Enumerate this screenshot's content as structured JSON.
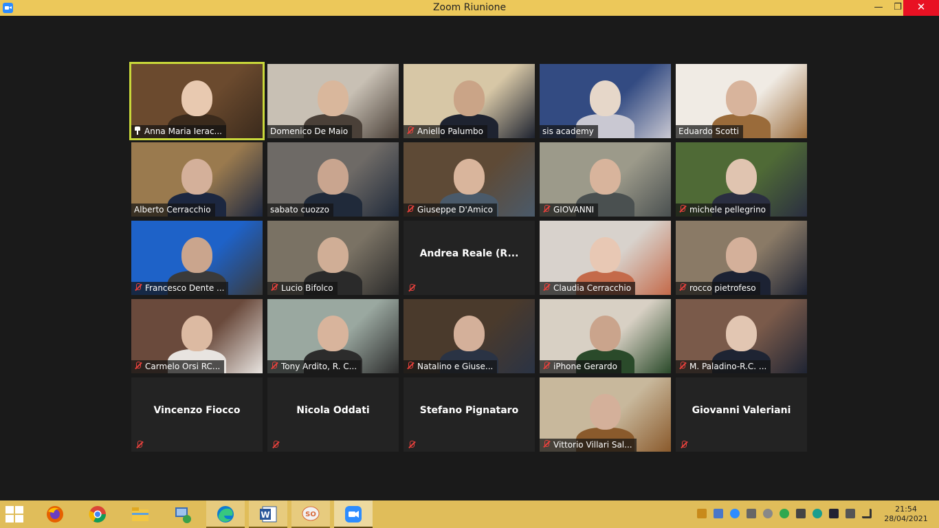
{
  "window": {
    "title": "Zoom Riunione",
    "minimize": "—",
    "maximize": "❐",
    "close": "✕"
  },
  "participants": [
    {
      "name": "Anna Maria Ierac...",
      "muted": false,
      "pinned": true,
      "video": true,
      "active": true
    },
    {
      "name": "Domenico De Maio",
      "muted": false,
      "video": true
    },
    {
      "name": "Aniello Palumbo",
      "muted": true,
      "video": true
    },
    {
      "name": "sis academy",
      "muted": false,
      "video": true
    },
    {
      "name": "Eduardo Scotti",
      "muted": false,
      "video": true
    },
    {
      "name": "Alberto Cerracchio",
      "muted": false,
      "video": true
    },
    {
      "name": "sabato cuozzo",
      "muted": false,
      "video": true
    },
    {
      "name": "Giuseppe D'Amico",
      "muted": true,
      "video": true
    },
    {
      "name": "GIOVANNI",
      "muted": true,
      "video": true
    },
    {
      "name": "michele pellegrino",
      "muted": true,
      "video": true
    },
    {
      "name": "Francesco Dente ...",
      "muted": true,
      "video": true
    },
    {
      "name": "Lucio Bifolco",
      "muted": true,
      "video": true
    },
    {
      "name": "Andrea Reale (R...",
      "muted": true,
      "video": false
    },
    {
      "name": "Claudia Cerracchio",
      "muted": true,
      "video": true
    },
    {
      "name": "rocco pietrofeso",
      "muted": true,
      "video": true
    },
    {
      "name": "Carmelo Orsi RC...",
      "muted": true,
      "video": true
    },
    {
      "name": "Tony Ardito, R. C...",
      "muted": true,
      "video": true
    },
    {
      "name": "Natalino e Giuse...",
      "muted": true,
      "video": true
    },
    {
      "name": "iPhone Gerardo",
      "muted": true,
      "video": true
    },
    {
      "name": "M. Paladino-R.C. ...",
      "muted": true,
      "video": true
    },
    {
      "name": "Vincenzo Fiocco",
      "muted": true,
      "video": false
    },
    {
      "name": "Nicola Oddati",
      "muted": true,
      "video": false
    },
    {
      "name": "Stefano Pignataro",
      "muted": true,
      "video": false
    },
    {
      "name": "Vittorio Villari Sal...",
      "muted": true,
      "video": true
    },
    {
      "name": "Giovanni Valeriani",
      "muted": true,
      "video": false
    }
  ],
  "taskbar": {
    "items": [
      "start-button",
      "firefox-icon",
      "chrome-icon",
      "file-explorer-icon",
      "network-app-icon",
      "edge-icon",
      "word-icon",
      "skype-icon",
      "zoom-icon"
    ],
    "clock": {
      "time": "21:54",
      "date": "28/04/2021"
    }
  },
  "colors": {
    "titlebar": "#ecc85a",
    "taskbar": "#e0bd5a",
    "stage": "#1a1a1a",
    "active_speaker_border": "#c9d83a",
    "muted_red": "#e8413c"
  }
}
